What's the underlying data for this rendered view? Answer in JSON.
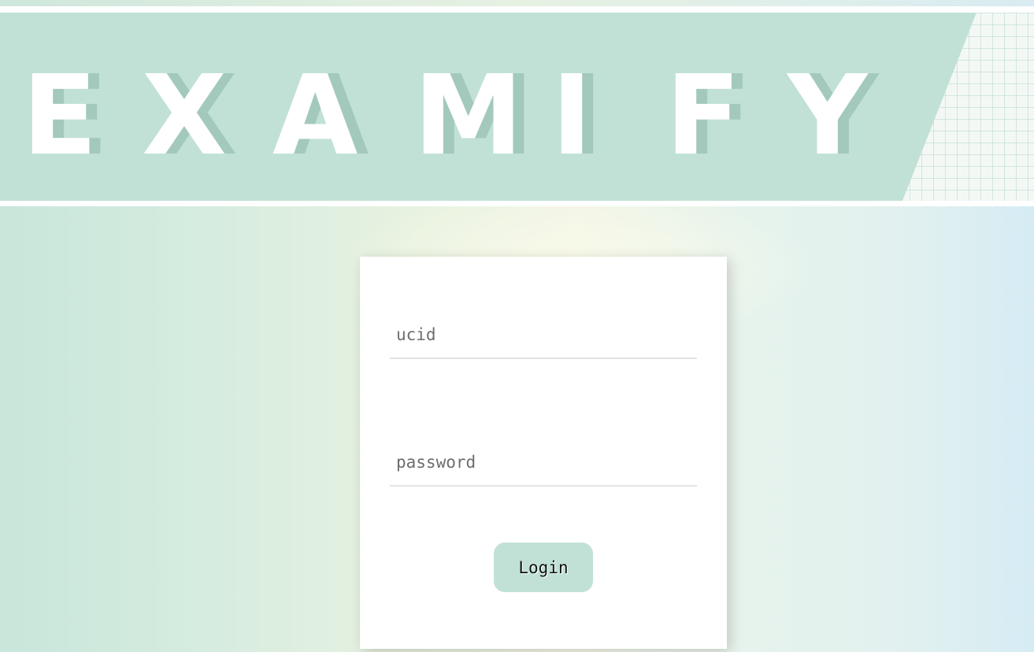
{
  "banner": {
    "logo_letters": [
      "E",
      "X",
      "A",
      "M",
      "I",
      "F",
      "Y"
    ],
    "background_color": "#c1e1d6",
    "letter_color": "#ffffff",
    "shadow_color": "#a3c9bd"
  },
  "login": {
    "ucid_placeholder": "ucid",
    "password_placeholder": "password",
    "button_label": "Login",
    "button_color": "#c1e1d6"
  }
}
